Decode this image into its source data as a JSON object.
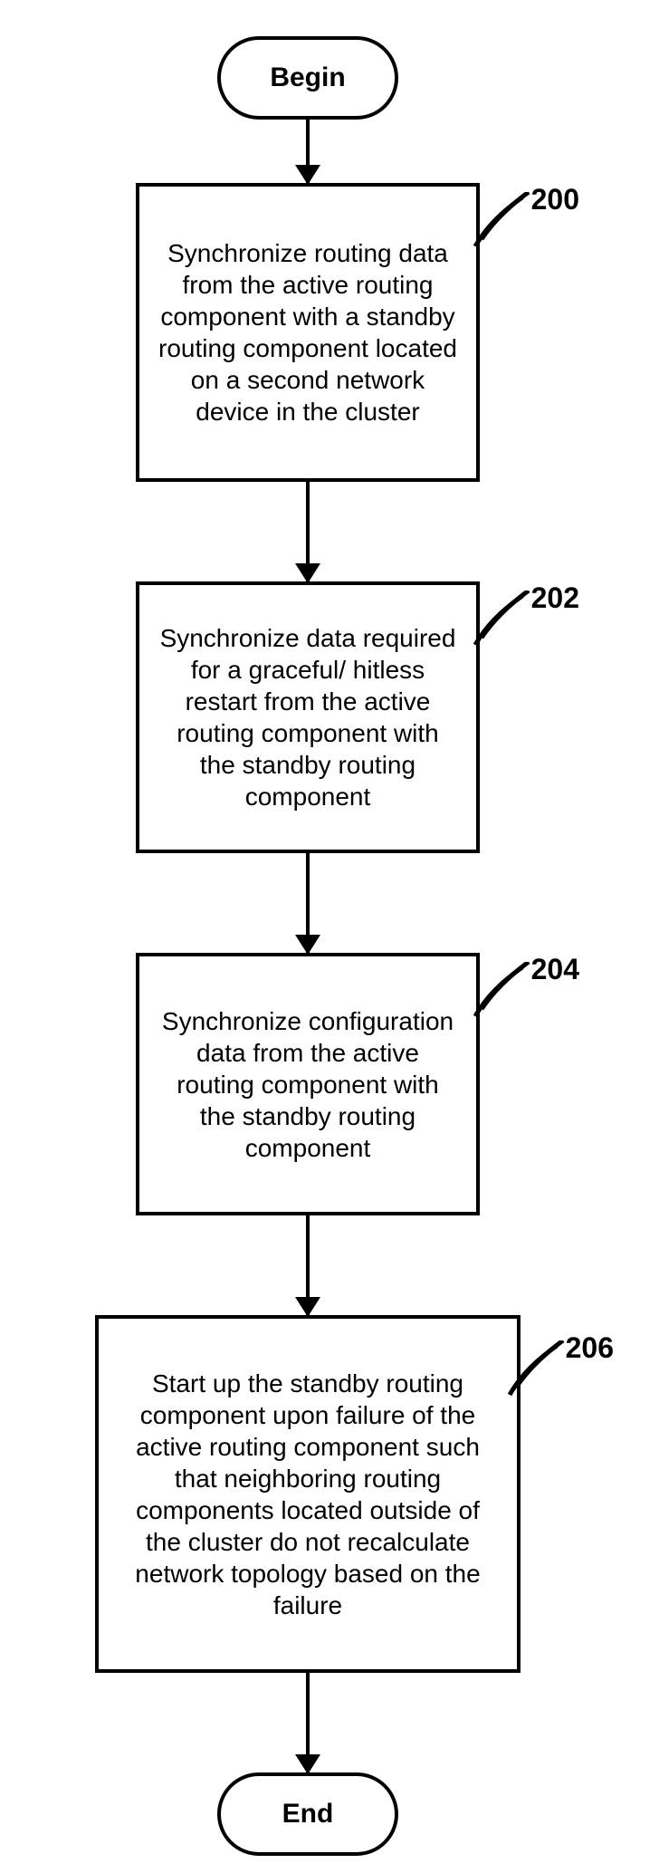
{
  "chart_data": {
    "type": "flowchart",
    "title": "",
    "nodes": [
      {
        "id": "begin",
        "shape": "terminator",
        "label": "Begin"
      },
      {
        "id": "200",
        "shape": "process",
        "ref": "200",
        "label": "Synchronize routing data from the active routing component with a standby routing component located on a second network device in the cluster"
      },
      {
        "id": "202",
        "shape": "process",
        "ref": "202",
        "label": "Synchronize data required for a graceful/ hitless restart from the active routing component with the standby routing component"
      },
      {
        "id": "204",
        "shape": "process",
        "ref": "204",
        "label": "Synchronize configuration data from the active routing component with the standby routing component"
      },
      {
        "id": "206",
        "shape": "process",
        "ref": "206",
        "label": "Start up the standby routing component upon failure of the active routing component such that neighboring routing components located outside of the cluster do not recalculate network topology based on the failure"
      },
      {
        "id": "end",
        "shape": "terminator",
        "label": "End"
      }
    ],
    "edges": [
      {
        "from": "begin",
        "to": "200"
      },
      {
        "from": "200",
        "to": "202"
      },
      {
        "from": "202",
        "to": "204"
      },
      {
        "from": "204",
        "to": "206"
      },
      {
        "from": "206",
        "to": "end"
      }
    ]
  },
  "terminators": {
    "begin": "Begin",
    "end": "End"
  },
  "steps": {
    "s200": {
      "ref": "200",
      "text": "Synchronize routing data from the active routing component with a standby routing component located on a second network device in the cluster"
    },
    "s202": {
      "ref": "202",
      "text": "Synchronize data required for a graceful/ hitless restart from the active routing component with the standby routing component"
    },
    "s204": {
      "ref": "204",
      "text": "Synchronize configuration data from the active routing component with the standby routing component"
    },
    "s206": {
      "ref": "206",
      "text": "Start up the standby routing component upon failure of the active routing component such that neighboring routing components located outside of the cluster do not recalculate network topology based on the failure"
    }
  }
}
